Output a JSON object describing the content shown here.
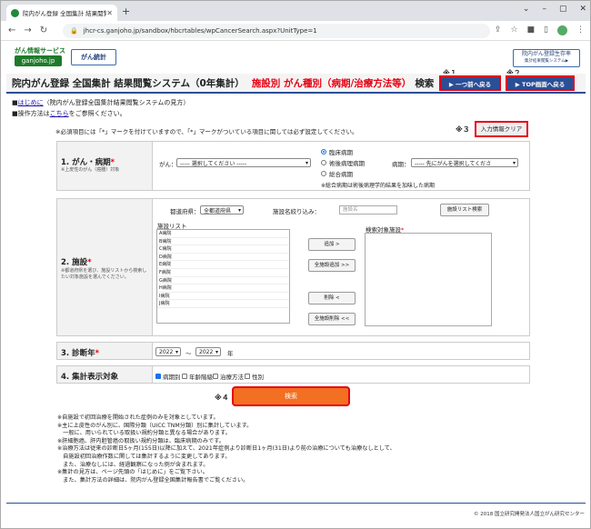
{
  "browser": {
    "tab_title": "院内がん登録 全国集計 結果閲覧",
    "url": "jhcr-cs.ganjoho.jp/sandbox/hbcrtables/wpCancerSearch.aspx?UnitType=1"
  },
  "header": {
    "logo_top": "がん情報サービス",
    "logo_domain": "ganjoho.jp",
    "logo_stats": "がん統計",
    "logo_right_main": "院内がん登録生存率",
    "logo_right_sub": "集計結果閲覧システム▶",
    "note1": "※１",
    "note2": "※２",
    "title_main": "院内がん登録 全国集計 結果閲覧システム（0年集計）",
    "title_red": "施設別 がん種別（病期/治療方法等）",
    "title_suffix": "検索",
    "btn_back": "▶ 一つ前へ戻る",
    "btn_top": "▶ TOP画面へ戻る"
  },
  "links": {
    "bullet": "■",
    "intro_link": "はじめに",
    "intro_suffix": "（院内がん登録全国集計結果閲覧システムの見方）",
    "op_prefix": "操作方法は",
    "op_link": "こちら",
    "op_suffix": "をご参照ください。"
  },
  "form": {
    "required_note": "※必須項目には「*」マークを付けていますので、「*」マークがついている項目に関しては必ず設定してください。",
    "note3": "※３",
    "clear_btn": "入力情報クリア",
    "sec1": {
      "label": "1. がん・病期",
      "asterisk": "*",
      "sub": "※上皮性のがん（癌腫）対象",
      "cancer_label": "がん：",
      "cancer_value": "----- 選択してください -----",
      "radio1": "臨床病期",
      "radio2": "術後病理病期",
      "radio3": "総合病期",
      "stage_label": "病期：",
      "stage_value": "----- 先にがんを選択してくださ",
      "stage_note": "※総合病期は術後病理学的結果を加味した病期"
    },
    "sec2": {
      "label": "2. 施設",
      "asterisk": "*",
      "sub1": "※都道府県を選び、施設リストから検索し",
      "sub2": "たい対象施設を選んでください。",
      "pref_label": "都道府県：",
      "pref_value": "全都道府県",
      "name_label": "施設名絞り込み：",
      "name_placeholder": "施設名",
      "list_search_btn": "施設リスト検索",
      "list_label": "施設リスト",
      "target_label": "検索対象施設",
      "target_asterisk": "*",
      "facilities": [
        "A病院",
        "B病院",
        "C病院",
        "D病院",
        "E病院",
        "F病院",
        "G病院",
        "H病院",
        "I病院",
        "J病院"
      ],
      "btn_add": "追加 >",
      "btn_add_all": "全施設追加 >>",
      "btn_del": "削除 <",
      "btn_del_all": "全施設削除 <<"
    },
    "sec3": {
      "label": "3. 診断年",
      "asterisk": "*",
      "from": "2022",
      "sep": "～",
      "to": "2022",
      "unit": "年"
    },
    "sec4": {
      "label": "4. 集計表示対象",
      "c1": "病期別",
      "c2": "年齢階級",
      "c3": "治療方法",
      "c4": "性別"
    },
    "note4": "※４",
    "search_btn": "検索"
  },
  "footnotes": [
    "※自施設で初回治療を開始された症例のみを対象としています。",
    "※主に上皮性のがん別に、国際分類（UICC TNM分類）別に集計しています。",
    "　一般に、用いられている取扱い規約分類と異なる場合があります。",
    "※肝細胞癌、肝内胆管癌の取扱い規約分類は、臨床病期のみです。",
    "※治療方法は従来の診断日5ヶ月(155日)以降に加えて、2021年症例より診断日1ヶ月(31日)より前の治療についても治療なしとして、",
    "　自施設初回治療作数に関しては集計するように変更してあります。",
    "　また、治療なしには、経過観察になった例が含まれます。",
    "※集計の見方は、ページ先頭の「はじめに」をご覧下さい。",
    "　また、集計方法の詳細は、院内がん登録全国集計報告書でご覧ください。"
  ],
  "copyright": "© 2018 国立研究開発法人国立がん研究センター"
}
